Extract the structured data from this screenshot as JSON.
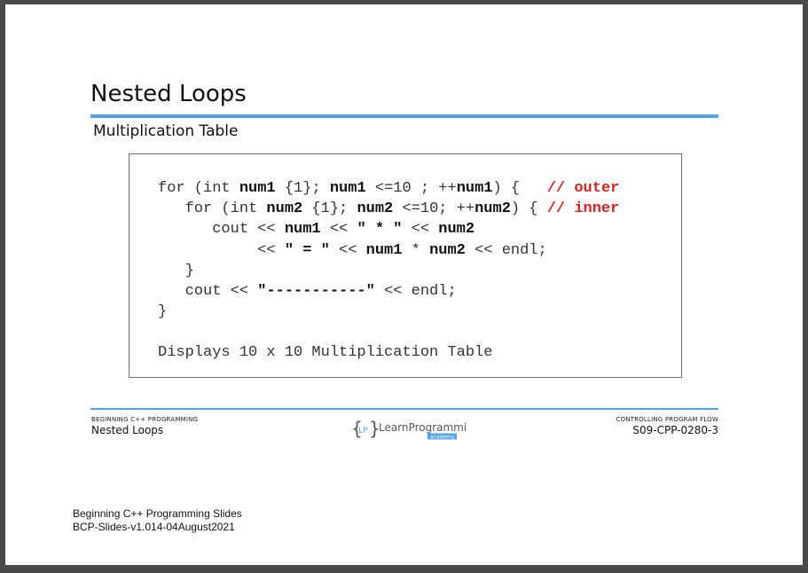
{
  "slide": {
    "title": "Nested Loops",
    "subtitle": "Multiplication Table"
  },
  "code": {
    "line1_pre": "for (int ",
    "line1_v1": "num1",
    "line1_mid1": " {1}; ",
    "line1_v2": "num1",
    "line1_mid2": " <=10 ; ++",
    "line1_v3": "num1",
    "line1_post": ") {   ",
    "line1_comment": "// outer",
    "line2_pre": "   for (int ",
    "line2_v1": "num2",
    "line2_mid1": " {1}; ",
    "line2_v2": "num2",
    "line2_mid2": " <=10; ++",
    "line2_v3": "num2",
    "line2_post": ") { ",
    "line2_comment": "// inner",
    "line3_pre": "      cout << ",
    "line3_v1": "num1",
    "line3_mid": " << ",
    "line3_str": "\" * \"",
    "line3_mid2": " << ",
    "line3_v2": "num2",
    "line4_pre": "           << ",
    "line4_str": "\" = \"",
    "line4_mid": " << ",
    "line4_v1": "num1",
    "line4_mid2": " * ",
    "line4_v2": "num2",
    "line4_post": " << endl;",
    "line5": "   }",
    "line6_pre": "   cout << ",
    "line6_str": "\"-----------\"",
    "line6_post": " << endl;",
    "line7": "}",
    "description": "Displays 10 x 10 Multiplication Table"
  },
  "footer": {
    "left_small": "BEGINNING C++ PROGRAMMING",
    "left_main": "Nested Loops",
    "right_small": "CONTROLLING PROGRAM FLOW",
    "right_main": "S09-CPP-0280-3",
    "logo_text": "LearnProgramming",
    "logo_sub": "academy",
    "logo_mark": "LP"
  },
  "notes": {
    "line1": "Beginning C++ Programming Slides",
    "line2": "BCP-Slides-v1.014-04August2021"
  },
  "colors": {
    "accent_blue": "#4ea3ea",
    "comment_red": "#e0201e"
  }
}
